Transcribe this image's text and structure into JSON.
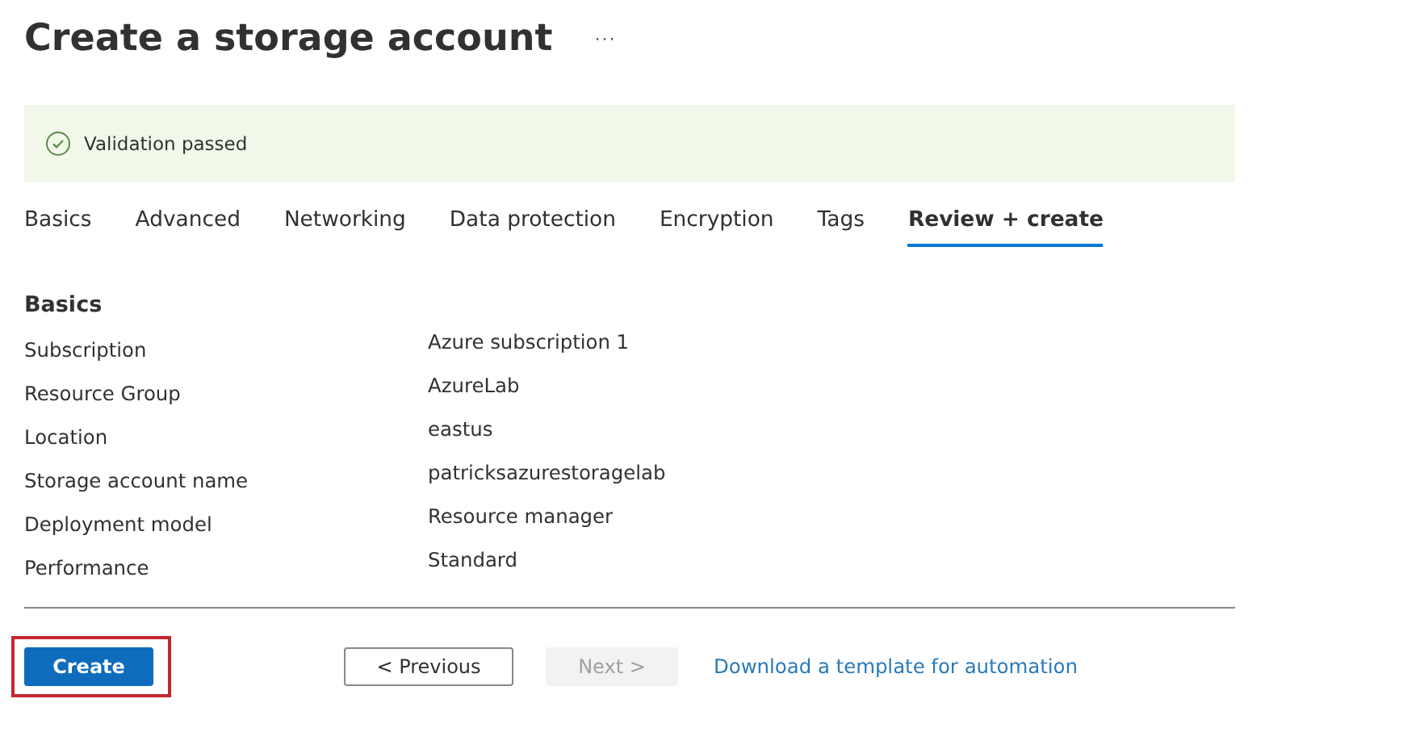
{
  "page": {
    "title": "Create a storage account",
    "more": "···"
  },
  "banner": {
    "kind": "success",
    "text": "Validation passed"
  },
  "tabs": [
    {
      "label": "Basics",
      "selected": false
    },
    {
      "label": "Advanced",
      "selected": false
    },
    {
      "label": "Networking",
      "selected": false
    },
    {
      "label": "Data protection",
      "selected": false
    },
    {
      "label": "Encryption",
      "selected": false
    },
    {
      "label": "Tags",
      "selected": false
    },
    {
      "label": "Review + create",
      "selected": true
    }
  ],
  "section": {
    "title": "Basics",
    "rows": [
      {
        "label": "Subscription",
        "value": "Azure subscription 1"
      },
      {
        "label": "Resource Group",
        "value": "AzureLab"
      },
      {
        "label": "Location",
        "value": "eastus"
      },
      {
        "label": "Storage account name",
        "value": "patricksazurestoragelab"
      },
      {
        "label": "Deployment model",
        "value": "Resource manager"
      },
      {
        "label": "Performance",
        "value": "Standard"
      }
    ]
  },
  "footer": {
    "buttons": [
      {
        "kind": "primary",
        "label": "Create",
        "highlighted": true,
        "disabled": false
      },
      {
        "kind": "secondary",
        "label": "< Previous",
        "highlighted": false,
        "disabled": false
      },
      {
        "kind": "secondary",
        "label": "Next >",
        "highlighted": false,
        "disabled": true
      }
    ],
    "link": "Download a template for automation"
  }
}
